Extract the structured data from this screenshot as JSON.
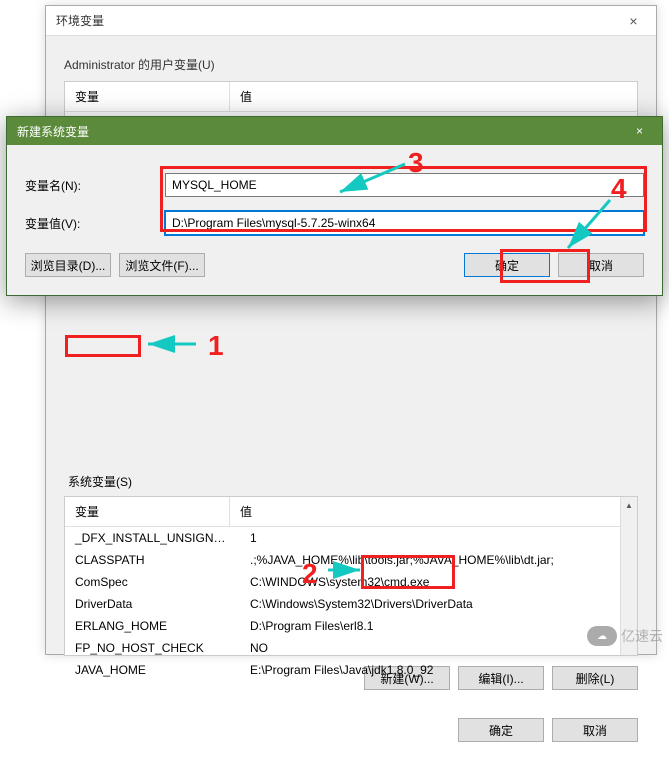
{
  "back_dialog": {
    "title": "环境变量",
    "close": "×",
    "user_section_label": "Administrator 的用户变量(U)",
    "header_var": "变量",
    "header_val": "值",
    "sys_section_label": "系统变量(S)",
    "sys_rows": [
      {
        "var": "_DFX_INSTALL_UNSIGNED...",
        "val": "1"
      },
      {
        "var": "CLASSPATH",
        "val": ".;%JAVA_HOME%\\lib\\tools.jar;%JAVA_HOME%\\lib\\dt.jar;"
      },
      {
        "var": "ComSpec",
        "val": "C:\\WINDOWS\\system32\\cmd.exe"
      },
      {
        "var": "DriverData",
        "val": "C:\\Windows\\System32\\Drivers\\DriverData"
      },
      {
        "var": "ERLANG_HOME",
        "val": "D:\\Program Files\\erl8.1"
      },
      {
        "var": "FP_NO_HOST_CHECK",
        "val": "NO"
      },
      {
        "var": "JAVA_HOME",
        "val": "E:\\Program Files\\Java\\jdk1.8.0_92"
      }
    ],
    "btn_new": "新建(W)...",
    "btn_edit": "编辑(I)...",
    "btn_delete": "删除(L)",
    "btn_ok": "确定",
    "btn_cancel": "取消"
  },
  "front_dialog": {
    "title": "新建系统变量",
    "close": "×",
    "label_name": "变量名(N):",
    "label_value": "变量值(V):",
    "value_name": "MYSQL_HOME",
    "value_value": "D:\\Program Files\\mysql-5.7.25-winx64",
    "btn_browse_dir": "浏览目录(D)...",
    "btn_browse_file": "浏览文件(F)...",
    "btn_ok": "确定",
    "btn_cancel": "取消"
  },
  "annotations": {
    "n1": "1",
    "n2": "2",
    "n3": "3",
    "n4": "4"
  },
  "watermark": {
    "logo": "☁",
    "text": "亿速云"
  }
}
